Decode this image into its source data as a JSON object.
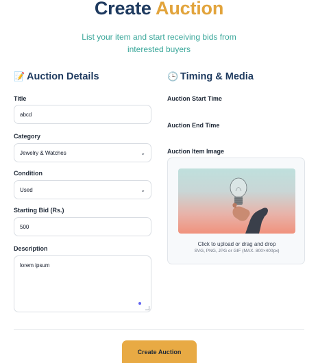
{
  "header": {
    "title_part1": "Create",
    "title_part2": "Auction",
    "subtitle": "List your item and start receiving bids from interested buyers"
  },
  "details": {
    "emoji": "📝",
    "heading": "Auction Details",
    "title_label": "Title",
    "title_value": "abcd",
    "category_label": "Category",
    "category_value": "Jewelry & Watches",
    "condition_label": "Condition",
    "condition_value": "Used",
    "bid_label": "Starting Bid (Rs.)",
    "bid_value": "500",
    "description_label": "Description",
    "description_value": "lorem ipsum"
  },
  "timing": {
    "emoji": "🕒",
    "heading": "Timing & Media",
    "start_label": "Auction Start Time",
    "end_label": "Auction End Time",
    "image_label": "Auction Item Image",
    "upload_text": "Click to upload or drag and drop",
    "upload_hint": "SVG, PNG, JPG or GIF (MAX. 800×400px)"
  },
  "submit_label": "Create Auction",
  "colors": {
    "navy": "#1e3a5f",
    "gold": "#e2a43c",
    "teal": "#3aa79a",
    "button": "#e8aa44"
  },
  "icons": {
    "chevron": "chevron-down-icon"
  }
}
